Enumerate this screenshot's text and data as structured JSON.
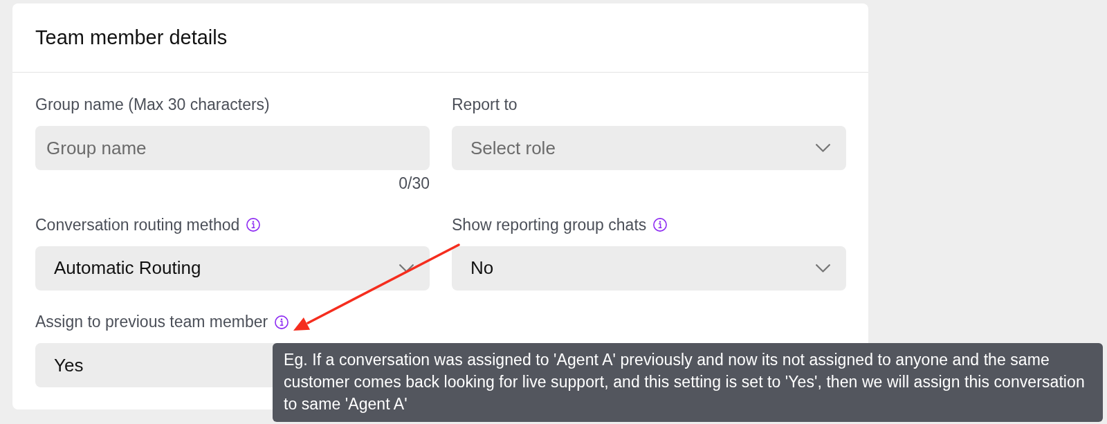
{
  "card": {
    "title": "Team member details"
  },
  "fields": [
    {
      "kind": "text",
      "label": "Group name (Max 30 characters)",
      "info": false,
      "placeholder": "Group name",
      "counter": "0/30"
    },
    {
      "kind": "select",
      "label": "Report to",
      "info": false,
      "placeholder": "Select role",
      "caret": true
    },
    {
      "kind": "select",
      "label": "Conversation routing method",
      "info": true,
      "value": "Automatic Routing",
      "caret": true
    },
    {
      "kind": "select",
      "label": "Show reporting group chats",
      "info": true,
      "value": "No",
      "caret": true
    },
    {
      "kind": "select",
      "label": "Assign to previous team member",
      "info": true,
      "value": "Yes",
      "caret": false
    }
  ],
  "tooltip": {
    "text": "Eg. If a conversation was assigned to 'Agent A' previously and now its not assigned to anyone and the same customer comes back looking for live support, and this setting is set to 'Yes', then we will assign this conversation to same 'Agent A'"
  },
  "annotations": [
    {
      "kind": "arrow"
    }
  ]
}
